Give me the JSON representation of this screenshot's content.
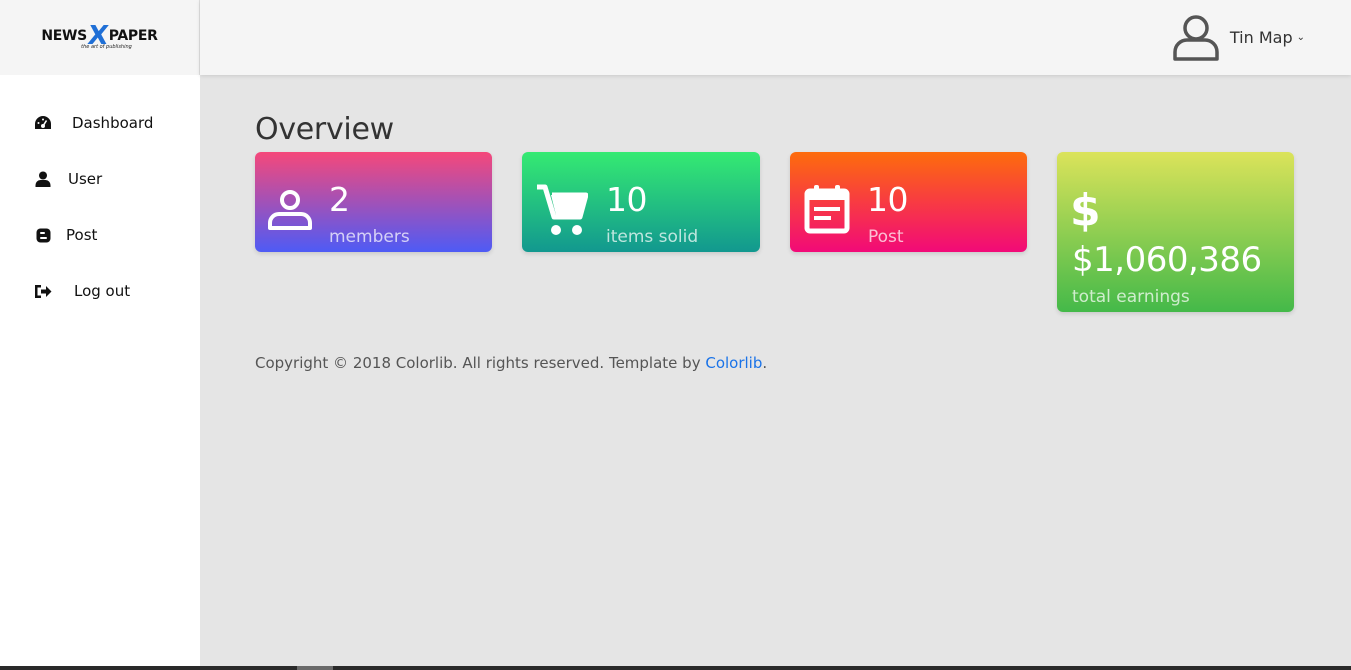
{
  "brand": {
    "logo_left": "NEWS",
    "logo_x": "X",
    "logo_right": "PAPER",
    "tagline": "the art of publishing"
  },
  "sidebar": {
    "items": [
      {
        "label": "Dashboard",
        "icon": "dashboard-icon"
      },
      {
        "label": "User",
        "icon": "user-icon"
      },
      {
        "label": "Post",
        "icon": "blogger-icon"
      },
      {
        "label": "Log out",
        "icon": "sign-out-icon"
      }
    ]
  },
  "header": {
    "account_name": "Tin Map",
    "caret": "⌄"
  },
  "main": {
    "title": "Overview",
    "cards": [
      {
        "value": "2",
        "label": "members",
        "icon": "user-icon"
      },
      {
        "value": "10",
        "label": "items solid",
        "icon": "cart-icon"
      },
      {
        "value": "10",
        "label": "Post",
        "icon": "calendar-note-icon"
      },
      {
        "value": "$1,060,386",
        "label": "total earnings",
        "icon": "dollar-icon",
        "icon_text": "$"
      }
    ]
  },
  "footer": {
    "text": "Copyright © 2018 Colorlib. All rights reserved. Template by ",
    "link": "Colorlib",
    "end": "."
  },
  "colors": {
    "accent_link": "#1a73e8",
    "logo_x": "#1f6fd6"
  }
}
